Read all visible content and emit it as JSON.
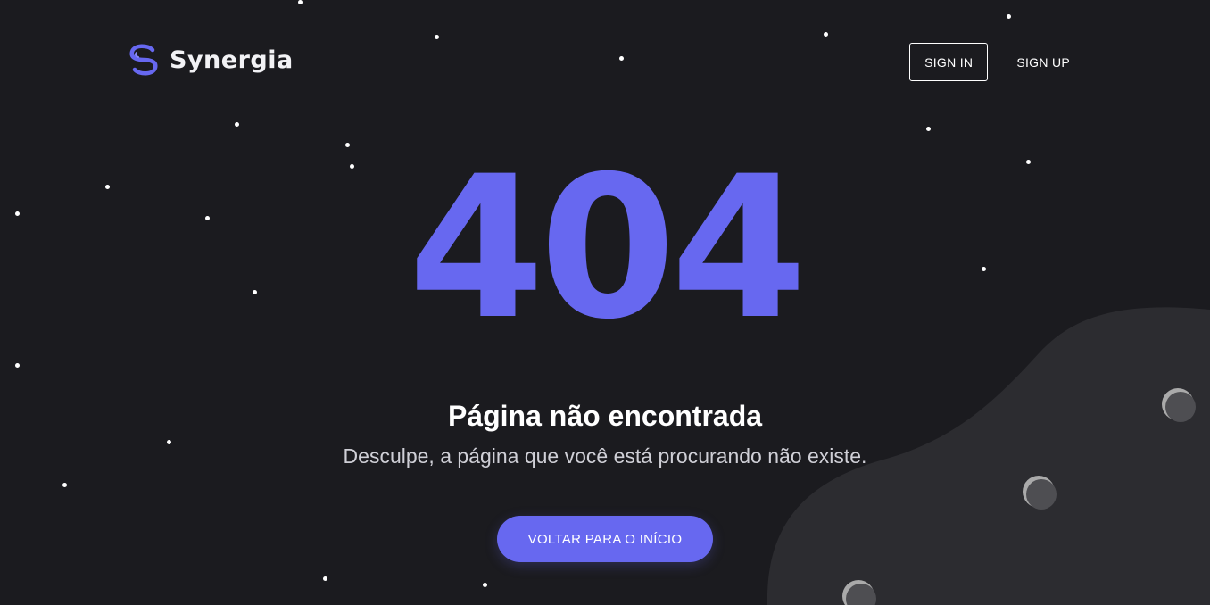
{
  "brand": {
    "name": "Synergia",
    "logo_icon": "synergia-s-logo-icon",
    "accent_color": "#6768f0"
  },
  "nav": {
    "signin_label": "SIGN IN",
    "signup_label": "SIGN UP"
  },
  "error": {
    "code": "404",
    "title": "Página não encontrada",
    "message": "Desculpe, a página que você está procurando não existe."
  },
  "cta": {
    "label": "VOLTAR PARA O INÍCIO"
  },
  "theme": {
    "background": "#1b1b1f",
    "planet": "#2c2c30",
    "crater": "#5a5a5e"
  }
}
